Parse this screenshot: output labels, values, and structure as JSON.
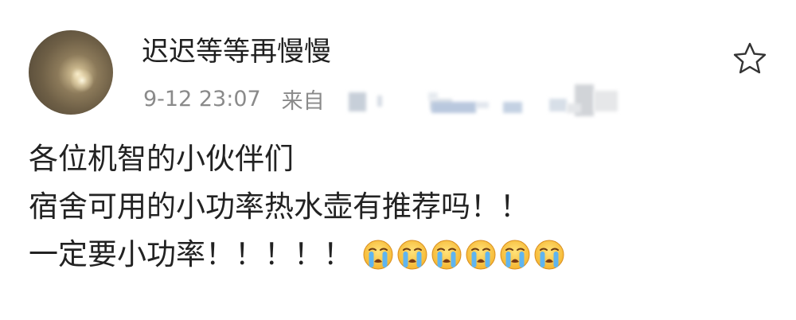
{
  "post": {
    "username": "迟迟等等再慢慢",
    "timestamp": "9-12 23:07",
    "source_prefix": "来自",
    "lines": [
      "各位机智的小伙伴们",
      "宿舍可用的小功率热水壶有推荐吗！！",
      "一定要小功率！！！！！"
    ],
    "emoji_name": "loudly-crying-emoji",
    "emoji_count": 6,
    "star_icon": "star-outline-icon"
  }
}
